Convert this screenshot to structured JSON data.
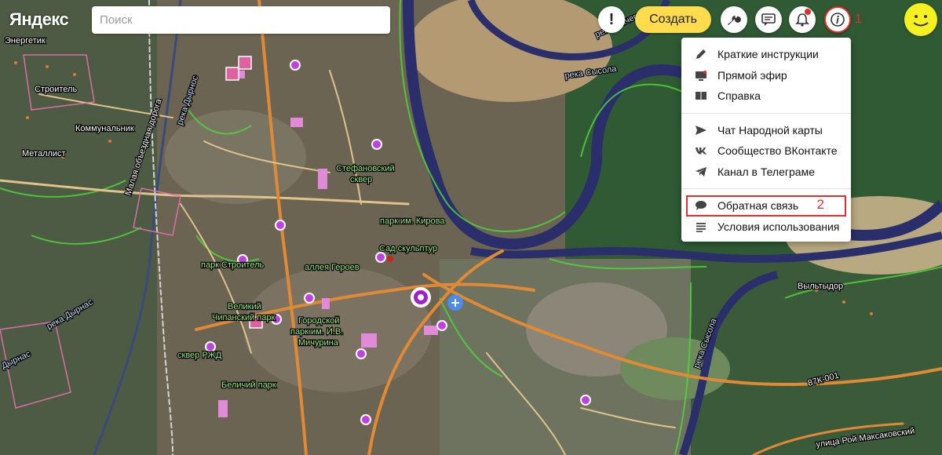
{
  "logo": "Яндекс",
  "search": {
    "placeholder": "Поиск"
  },
  "toolbar": {
    "exclamation": "!",
    "create_label": "Создать",
    "annotation_1": "1"
  },
  "menu": {
    "items_group1": [
      {
        "label": "Краткие инструкции",
        "icon": "pencil-icon"
      },
      {
        "label": "Прямой эфир",
        "icon": "live-broadcast-icon"
      },
      {
        "label": "Справка",
        "icon": "book-icon"
      }
    ],
    "items_group2": [
      {
        "label": "Чат Народной карты",
        "icon": "send-icon"
      },
      {
        "label": "Сообщество ВКонтакте",
        "icon": "vk-icon"
      },
      {
        "label": "Канал в Телеграме",
        "icon": "telegram-icon"
      }
    ],
    "items_group3": [
      {
        "label": "Обратная связь",
        "icon": "speech-bubble-icon",
        "annotation": "2"
      },
      {
        "label": "Условия использования",
        "icon": "list-lines-icon"
      }
    ]
  },
  "map_labels": {
    "energetik": "Энергетик",
    "stroitel": "Строитель",
    "kommunalnik": "Коммунальник",
    "metallist": "Металлист",
    "malaya_road": "Малая объездная дорога",
    "reka_daryonas": "река Дырнос",
    "reka_daryonas_2": "река Дырнас",
    "reka_daryonas_3": "Дырнас",
    "park_stroitel": "парк Строитель",
    "velikiy": "Великий",
    "chipanskiy": "Чипанский парк",
    "gorodskoy": "Городской",
    "park_michurina": "парк им. И.В.",
    "michurina": "Мичурина",
    "skver_rzhd": "сквер РЖД",
    "belichiy": "Беличий парк",
    "stefanovskiy": "Стефановский",
    "skver": "сквер",
    "park_kirova": "парк им. Кирова",
    "sad_skulptur": "Сад скульптур",
    "alleya": "аллея Героев",
    "reka_sysola": "река Сысола",
    "reka_sysola_2": "река Сысола",
    "reka_vychegda": "река Вычегда",
    "vyltydor": "Выльтыдор",
    "road_87k": "87К-001",
    "ul_makarovsky": "улица Рой Максаковский"
  }
}
